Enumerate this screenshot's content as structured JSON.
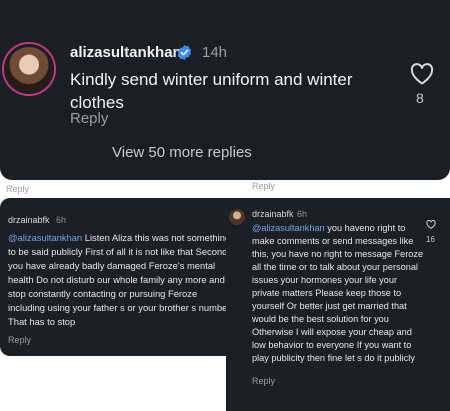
{
  "main_comment": {
    "username": "alizasultankhan",
    "verified_icon": "verified-badge-icon",
    "time": "14h",
    "text": "Kindly send winter uniform and winter clothes",
    "reply_label": "Reply",
    "likes": "8",
    "view_more": "View 50 more replies"
  },
  "left_panel_reply_label": "Reply",
  "right_panel_reply_label": "Reply",
  "left_comment": {
    "username": "drzainabfk",
    "time": "6h",
    "mention": "@alizasultankhan",
    "text": "Listen Aliza this was not something to be said publicly First of all it is not like that Second you have already badly damaged Feroze's mental health Do not disturb our whole family any more and stop constantly contacting or pursuing Feroze including using your father s or your brother s number That has to stop",
    "reply_label": "Reply"
  },
  "right_comment": {
    "username": "drzainabfk",
    "time": "6h",
    "mention": "@alizasultankhan",
    "text": "you haveno right to make comments or send messages like this, you have no right to message Feroze all the time or to talk about your personal issues your hormones your life your private matters Please keep those to yourself Or better just get married that would be the best solution for you Otherwise I will expose your cheap and low behavior to everyone If you want to play publicity then fine let s do it publicly",
    "reply_label": "Reply",
    "likes": "16"
  },
  "colors": {
    "background_dark": "#1c1e26",
    "mention_blue": "#6fa4e0",
    "verified_blue": "#3d8bf2"
  }
}
